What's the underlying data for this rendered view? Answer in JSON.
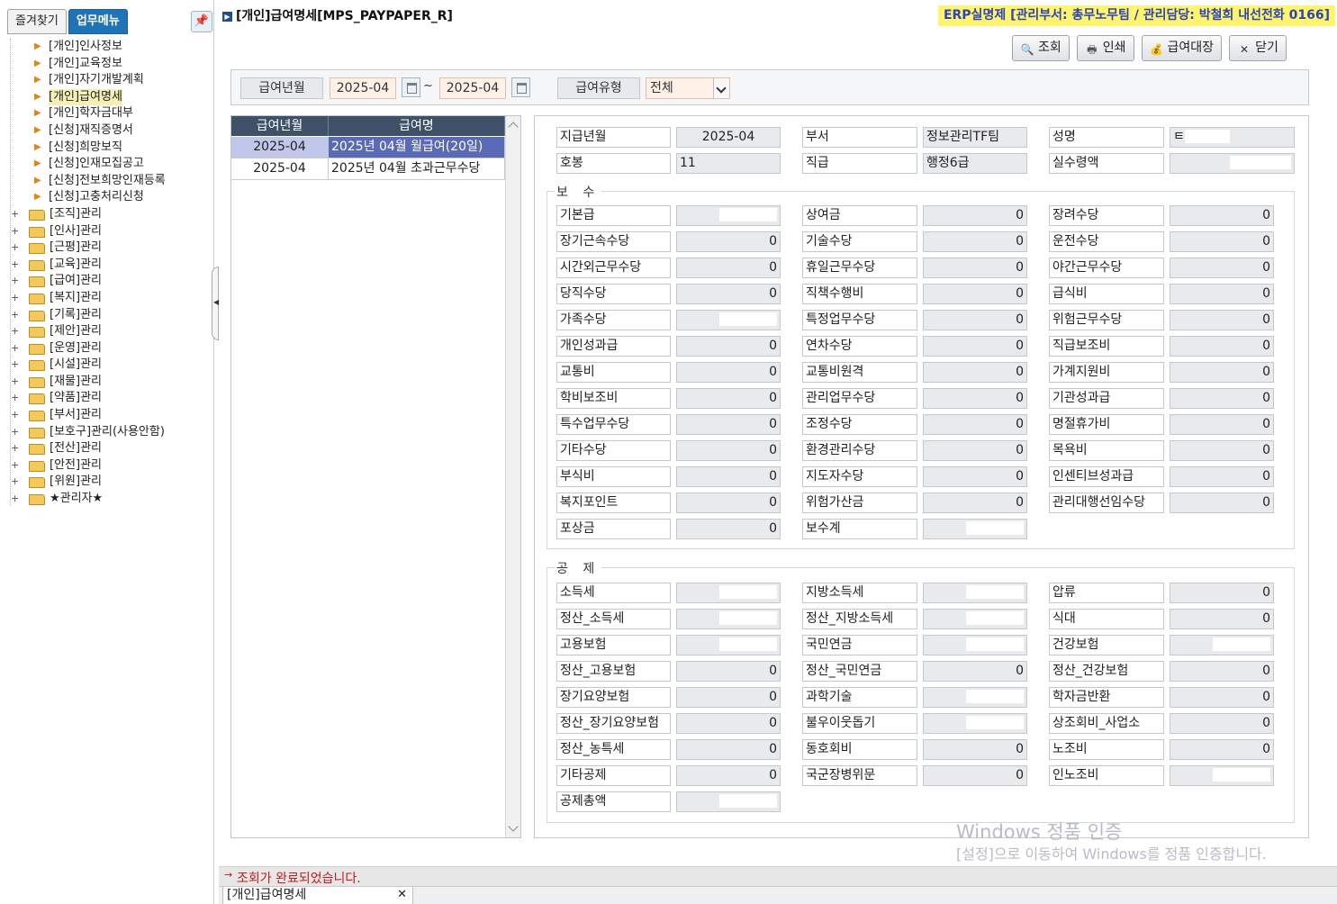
{
  "sidebar": {
    "tabs": [
      {
        "label": "즐겨찾기"
      },
      {
        "label": "업무메뉴"
      }
    ],
    "items": [
      {
        "label": "[개인]인사정보",
        "type": "leaf"
      },
      {
        "label": "[개인]교육정보",
        "type": "leaf"
      },
      {
        "label": "[개인]자기개발계획",
        "type": "leaf"
      },
      {
        "label": "[개인]급여명세",
        "type": "leaf"
      },
      {
        "label": "[개인]학자금대부",
        "type": "leaf"
      },
      {
        "label": "[신청]재직증명서",
        "type": "leaf"
      },
      {
        "label": "[신청]희망보직",
        "type": "leaf"
      },
      {
        "label": "[신청]인재모집공고",
        "type": "leaf"
      },
      {
        "label": "[신청]전보희망인재등록",
        "type": "leaf"
      },
      {
        "label": "[신청]고충처리신청",
        "type": "leaf"
      },
      {
        "label": "[조직]관리",
        "type": "folder"
      },
      {
        "label": "[인사]관리",
        "type": "folder"
      },
      {
        "label": "[근평]관리",
        "type": "folder"
      },
      {
        "label": "[교육]관리",
        "type": "folder"
      },
      {
        "label": "[급여]관리",
        "type": "folder"
      },
      {
        "label": "[복지]관리",
        "type": "folder"
      },
      {
        "label": "[기록]관리",
        "type": "folder"
      },
      {
        "label": "[제안]관리",
        "type": "folder"
      },
      {
        "label": "[운영]관리",
        "type": "folder"
      },
      {
        "label": "[시설]관리",
        "type": "folder"
      },
      {
        "label": "[재물]관리",
        "type": "folder"
      },
      {
        "label": "[약품]관리",
        "type": "folder"
      },
      {
        "label": "[부서]관리",
        "type": "folder"
      },
      {
        "label": "[보호구]관리(사용안함)",
        "type": "folder"
      },
      {
        "label": "[전산]관리",
        "type": "folder"
      },
      {
        "label": "[안전]관리",
        "type": "folder"
      },
      {
        "label": "[위원]관리",
        "type": "folder"
      },
      {
        "label": "★관리자★",
        "type": "folder"
      }
    ]
  },
  "header": {
    "title": "[개인]급여명세[MPS_PAYPAPER_R]",
    "erp_info": "ERP실명제 [관리부서: 총무노무팀 / 관리담당: 박철희 내선전화 0166]"
  },
  "toolbar": {
    "search": "조회",
    "print": "인쇄",
    "ledger": "급여대장",
    "close": "닫기"
  },
  "filters": {
    "period_label": "급여년월",
    "from": "2025-04",
    "tilde": "~",
    "to": "2025-04",
    "type_label": "급여유형",
    "type_value": "전체"
  },
  "paylist": {
    "headers": [
      "급여년월",
      "급여명"
    ],
    "rows": [
      {
        "month": "2025-04",
        "name": "2025년 04월 월급여(20일)"
      },
      {
        "month": "2025-04",
        "name": "2025년 04월 초과근무수당"
      }
    ]
  },
  "info": {
    "pay_month_label": "지급년월",
    "pay_month": "2025-04",
    "dept_label": "부서",
    "dept": "정보관리TF팀",
    "name_label": "성명",
    "name": "ㅌ",
    "step_label": "호봉",
    "step": "11",
    "grade_label": "직급",
    "grade": "행정6급",
    "net_label": "실수령액"
  },
  "pay": {
    "title": "보 수",
    "fields": [
      {
        "label": "기본급",
        "value": ""
      },
      {
        "label": "상여금",
        "value": "0"
      },
      {
        "label": "장려수당",
        "value": "0"
      },
      {
        "label": "장기근속수당",
        "value": "0"
      },
      {
        "label": "기술수당",
        "value": "0"
      },
      {
        "label": "운전수당",
        "value": "0"
      },
      {
        "label": "시간외근무수당",
        "value": "0"
      },
      {
        "label": "휴일근무수당",
        "value": "0"
      },
      {
        "label": "야간근무수당",
        "value": "0"
      },
      {
        "label": "당직수당",
        "value": "0"
      },
      {
        "label": "직책수행비",
        "value": "0"
      },
      {
        "label": "급식비",
        "value": "0"
      },
      {
        "label": "가족수당",
        "value": ""
      },
      {
        "label": "특정업무수당",
        "value": "0"
      },
      {
        "label": "위험근무수당",
        "value": "0"
      },
      {
        "label": "개인성과급",
        "value": "0"
      },
      {
        "label": "연차수당",
        "value": "0"
      },
      {
        "label": "직급보조비",
        "value": "0"
      },
      {
        "label": "교통비",
        "value": "0"
      },
      {
        "label": "교통비원격",
        "value": "0"
      },
      {
        "label": "가계지원비",
        "value": "0"
      },
      {
        "label": "학비보조비",
        "value": "0"
      },
      {
        "label": "관리업무수당",
        "value": "0"
      },
      {
        "label": "기관성과급",
        "value": "0"
      },
      {
        "label": "특수업무수당",
        "value": "0"
      },
      {
        "label": "조정수당",
        "value": "0"
      },
      {
        "label": "명절휴가비",
        "value": "0"
      },
      {
        "label": "기타수당",
        "value": "0"
      },
      {
        "label": "환경관리수당",
        "value": "0"
      },
      {
        "label": "목욕비",
        "value": "0"
      },
      {
        "label": "부식비",
        "value": "0"
      },
      {
        "label": "지도자수당",
        "value": "0"
      },
      {
        "label": "인센티브성과급",
        "value": "0"
      },
      {
        "label": "복지포인트",
        "value": "0"
      },
      {
        "label": "위험가산금",
        "value": "0"
      },
      {
        "label": "관리대행선임수당",
        "value": "0"
      },
      {
        "label": "포상금",
        "value": "0"
      },
      {
        "label": "보수계",
        "value": ""
      }
    ]
  },
  "deduction": {
    "title": "공 제",
    "fields": [
      {
        "label": "소득세",
        "value": ""
      },
      {
        "label": "지방소득세",
        "value": ""
      },
      {
        "label": "압류",
        "value": "0"
      },
      {
        "label": "정산_소득세",
        "value": ""
      },
      {
        "label": "정산_지방소득세",
        "value": ""
      },
      {
        "label": "식대",
        "value": "0"
      },
      {
        "label": "고용보험",
        "value": ""
      },
      {
        "label": "국민연금",
        "value": ""
      },
      {
        "label": "건강보험",
        "value": ""
      },
      {
        "label": "정산_고용보험",
        "value": "0"
      },
      {
        "label": "정산_국민연금",
        "value": "0"
      },
      {
        "label": "정산_건강보험",
        "value": "0"
      },
      {
        "label": "장기요양보험",
        "value": "0"
      },
      {
        "label": "과학기술",
        "value": ""
      },
      {
        "label": "학자금반환",
        "value": "0"
      },
      {
        "label": "정산_장기요양보험",
        "value": "0"
      },
      {
        "label": "불우이웃돕기",
        "value": ""
      },
      {
        "label": "상조회비_사업소",
        "value": "0"
      },
      {
        "label": "정산_농특세",
        "value": "0"
      },
      {
        "label": "동호회비",
        "value": "0"
      },
      {
        "label": "노조비",
        "value": "0"
      },
      {
        "label": "기타공제",
        "value": "0"
      },
      {
        "label": "국군장병위문",
        "value": "0"
      },
      {
        "label": "인노조비",
        "value": ""
      },
      {
        "label": "공제총액",
        "value": ""
      }
    ]
  },
  "status": {
    "message": "조회가 완료되었습니다.",
    "tab": "[개인]급여명세"
  },
  "watermark": {
    "line1": "Windows 정품 인증",
    "line2": "[설정]으로 이동하여 Windows를 정품 인증합니다."
  }
}
